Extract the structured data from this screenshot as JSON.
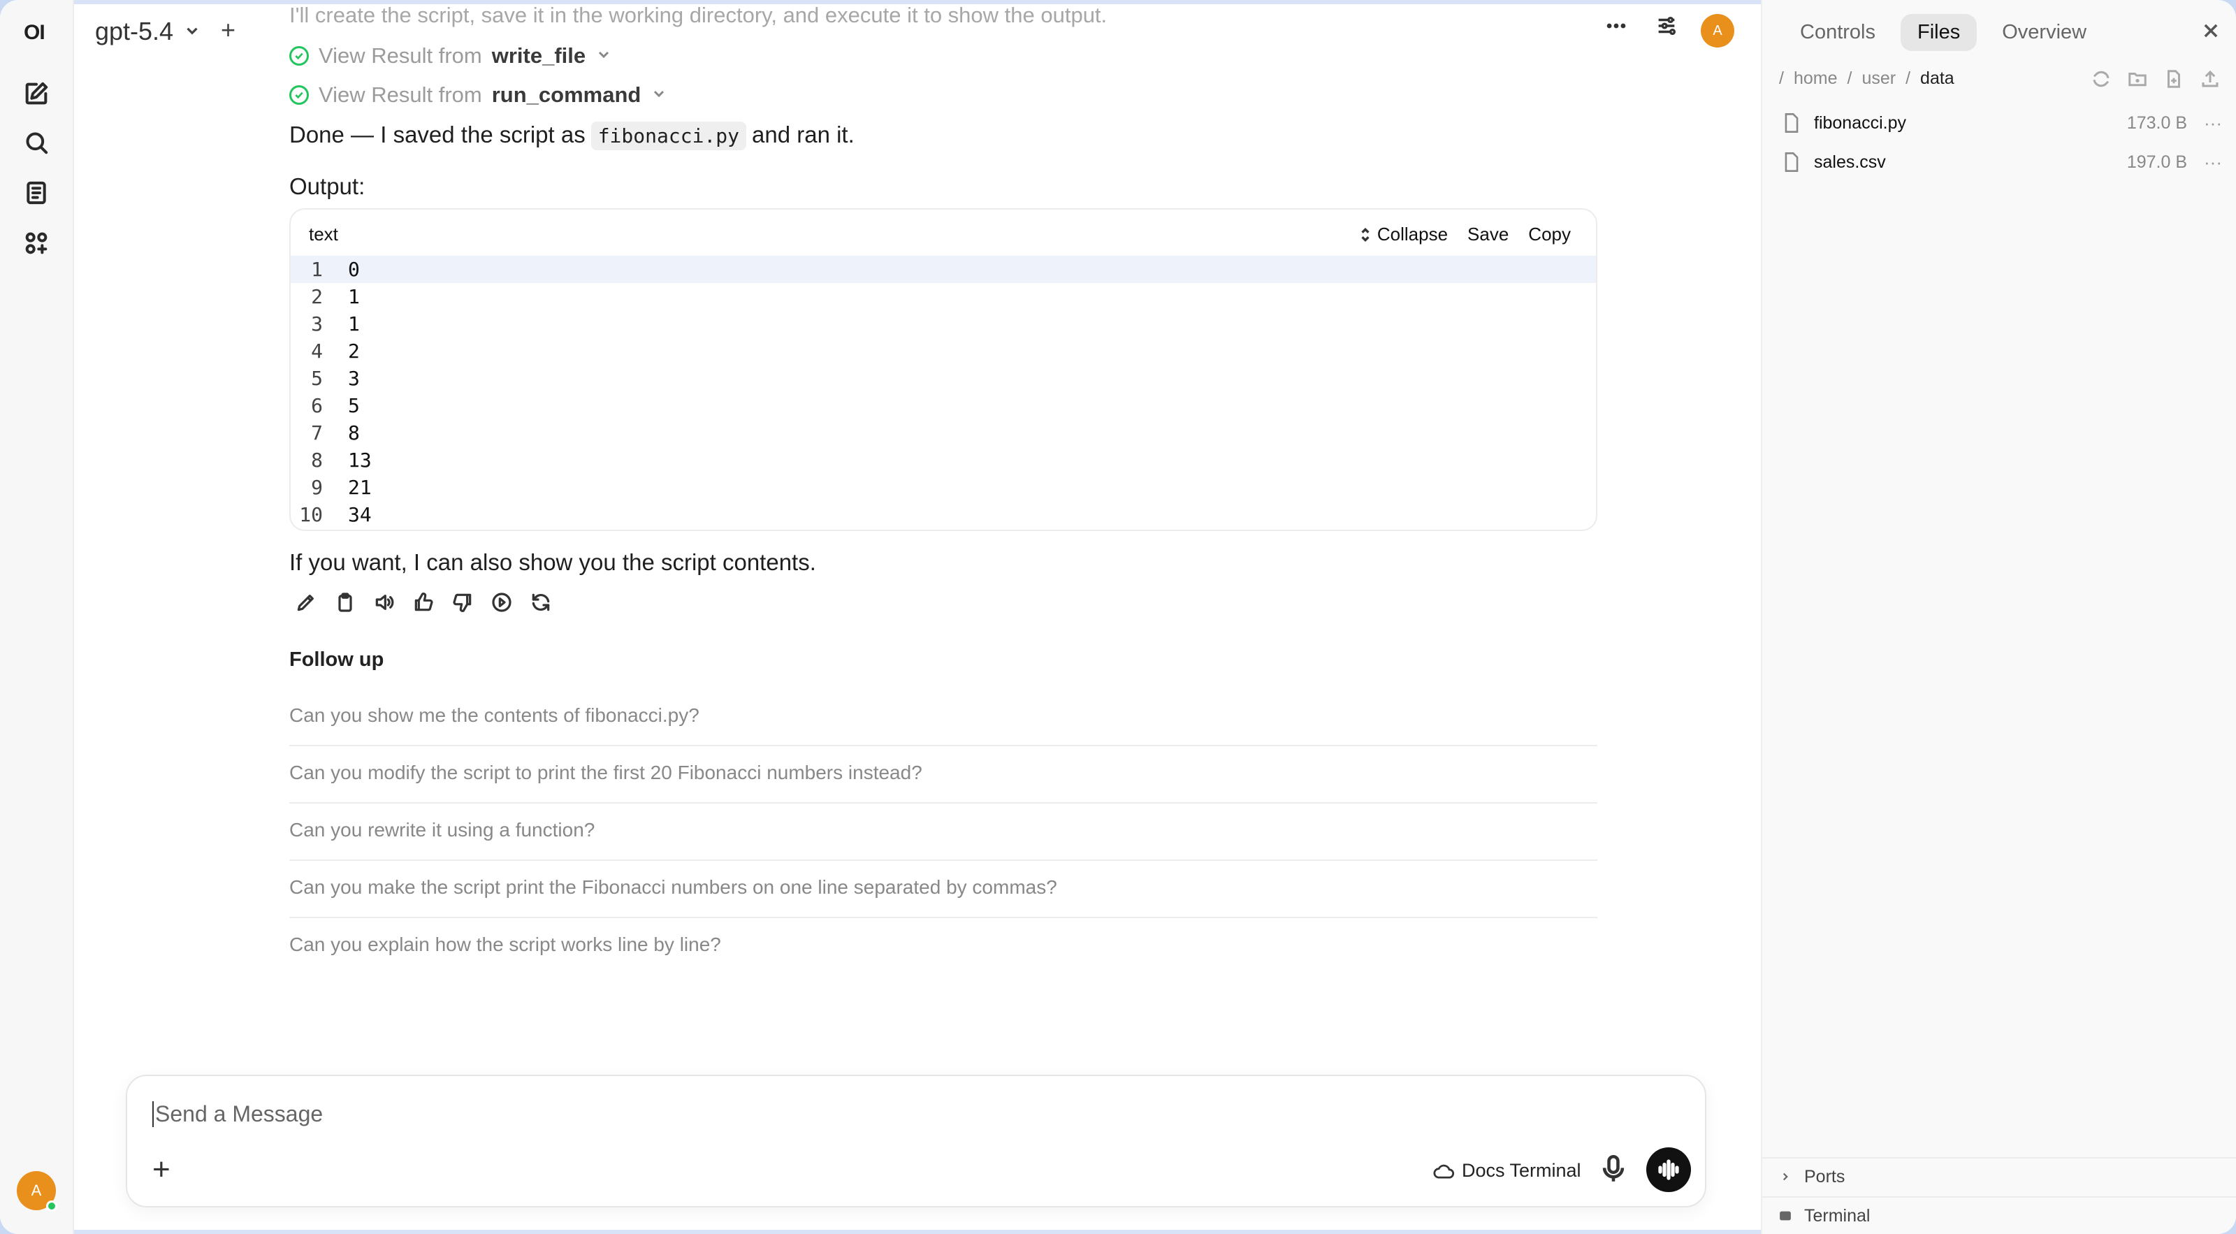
{
  "sidebar": {
    "logo": "OI",
    "user_initial": "A"
  },
  "header": {
    "model": "gpt-5.4",
    "new_chat": "+",
    "user_initial": "A"
  },
  "chat": {
    "faded_line": "I'll create the script, save it in the working directory, and execute it to show the output.",
    "tool_results": [
      {
        "prefix": "View Result from",
        "name": "write_file"
      },
      {
        "prefix": "View Result from",
        "name": "run_command"
      }
    ],
    "done_before": "Done — I saved the script as",
    "done_code": "fibonacci.py",
    "done_after": "and ran it.",
    "output_label": "Output:",
    "code_block": {
      "language": "text",
      "collapse": "Collapse",
      "save": "Save",
      "copy": "Copy",
      "lines": [
        {
          "n": "1",
          "v": "0"
        },
        {
          "n": "2",
          "v": "1"
        },
        {
          "n": "3",
          "v": "1"
        },
        {
          "n": "4",
          "v": "2"
        },
        {
          "n": "5",
          "v": "3"
        },
        {
          "n": "6",
          "v": "5"
        },
        {
          "n": "7",
          "v": "8"
        },
        {
          "n": "8",
          "v": "13"
        },
        {
          "n": "9",
          "v": "21"
        },
        {
          "n": "10",
          "v": "34"
        }
      ]
    },
    "closing": "If you want, I can also show you the script contents.",
    "follow_up_title": "Follow up",
    "follow_ups": [
      "Can you show me the contents of fibonacci.py?",
      "Can you modify the script to print the first 20 Fibonacci numbers instead?",
      "Can you rewrite it using a function?",
      "Can you make the script print the Fibonacci numbers on one line separated by commas?",
      "Can you explain how the script works line by line?"
    ]
  },
  "composer": {
    "placeholder": "Send a Message",
    "plus": "+",
    "docs_terminal": "Docs Terminal"
  },
  "panel": {
    "tabs": [
      "Controls",
      "Files",
      "Overview"
    ],
    "breadcrumb": [
      "/",
      "home",
      "/",
      "user",
      "/",
      "data"
    ],
    "files": [
      {
        "name": "fibonacci.py",
        "size": "173.0 B",
        "more": "···"
      },
      {
        "name": "sales.csv",
        "size": "197.0 B",
        "more": "···"
      }
    ],
    "ports": "Ports",
    "terminal": "Terminal"
  }
}
